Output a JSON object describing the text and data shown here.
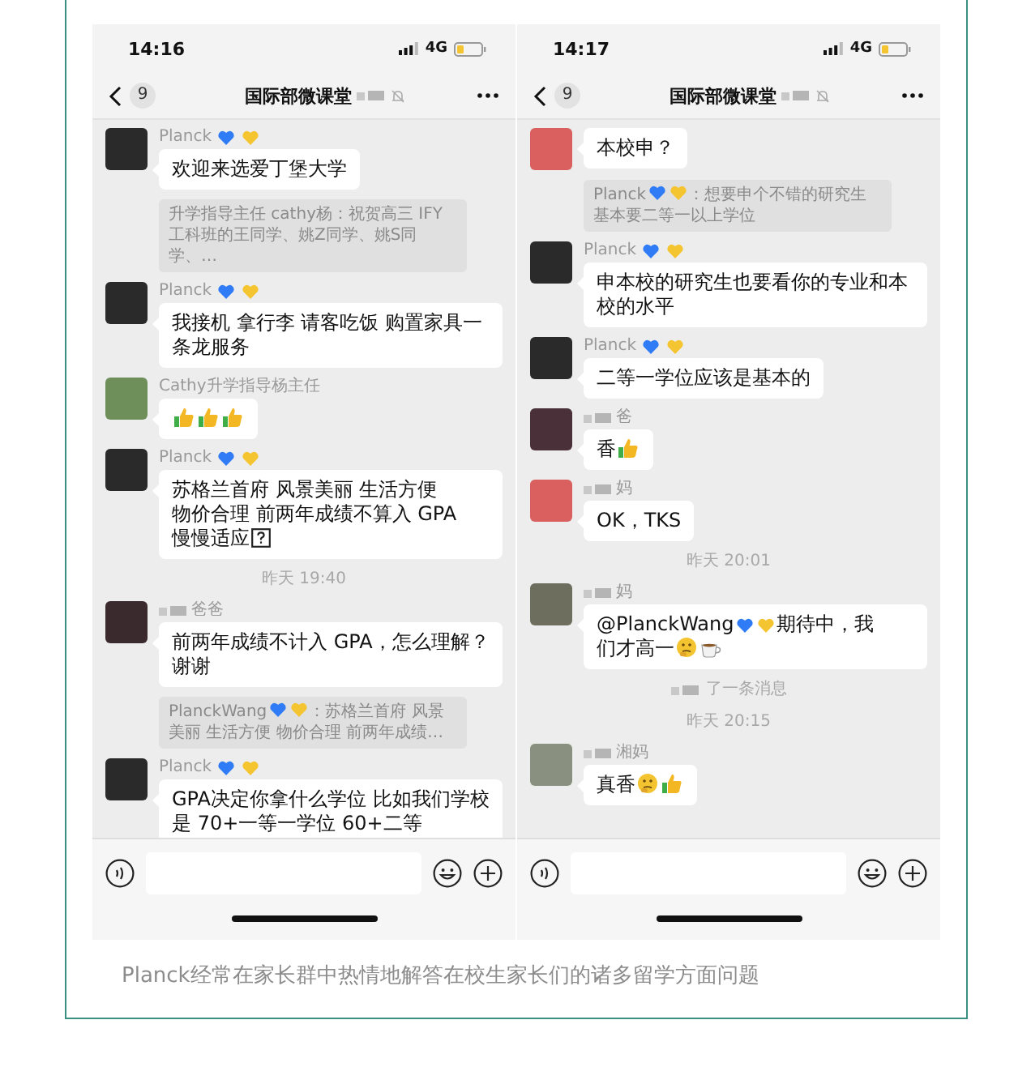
{
  "phones": [
    {
      "status": {
        "time": "14:16",
        "network": "4G"
      },
      "nav": {
        "badge": "9",
        "title": "国际部微课堂",
        "redacted": true,
        "muted": true
      },
      "messages": [
        {
          "kind": "message",
          "sender": {
            "name": "Planck",
            "badges": [
              {
                "kind": "heart",
                "color": "#2f7cf6"
              },
              {
                "kind": "heart",
                "color": "#f5c431"
              }
            ]
          },
          "avatar": {
            "color": "#2a2a2a"
          },
          "parts": [
            {
              "kind": "text",
              "text": "欢迎来选爱丁堡大学"
            }
          ]
        },
        {
          "kind": "quote",
          "parts": [
            {
              "kind": "text",
              "text": "升学指导主任 cathy杨：祝贺高三 IFY 工科班的王同学、姚Z同学、姚S同学、…"
            }
          ]
        },
        {
          "kind": "message",
          "sender": {
            "name": "Planck",
            "badges": [
              {
                "kind": "heart",
                "color": "#2f7cf6"
              },
              {
                "kind": "heart",
                "color": "#f5c431"
              }
            ]
          },
          "avatar": {
            "color": "#2a2a2a"
          },
          "parts": [
            {
              "kind": "text",
              "text": "我接机 拿行李 请客吃饭 购置家具一条龙服务"
            }
          ]
        },
        {
          "kind": "message",
          "sender": {
            "name": "Cathy升学指导杨主任"
          },
          "avatar": {
            "color": "#6f8f5a"
          },
          "parts": [
            {
              "kind": "thumb"
            },
            {
              "kind": "thumb"
            },
            {
              "kind": "thumb"
            }
          ]
        },
        {
          "kind": "message",
          "sender": {
            "name": "Planck",
            "badges": [
              {
                "kind": "heart",
                "color": "#2f7cf6"
              },
              {
                "kind": "heart",
                "color": "#f5c431"
              }
            ]
          },
          "avatar": {
            "color": "#2a2a2a"
          },
          "parts": [
            {
              "kind": "text",
              "text": "苏格兰首府 风景美丽 生活方便"
            },
            {
              "kind": "text",
              "text": "物价合理 前两年成绩不算入 GPA"
            },
            {
              "kind": "text",
              "text": "慢慢适应"
            },
            {
              "kind": "unknown"
            }
          ]
        },
        {
          "kind": "time",
          "text": "昨天 19:40"
        },
        {
          "kind": "message",
          "sender": {
            "name": "爸爸",
            "redacted": true
          },
          "avatar": {
            "color": "#3a2a2e"
          },
          "parts": [
            {
              "kind": "text",
              "text": "前两年成绩不计入 GPA，怎么理解？谢谢"
            }
          ]
        },
        {
          "kind": "quote",
          "parts": [
            {
              "kind": "text",
              "text": "PlanckWang"
            },
            {
              "kind": "heart",
              "color": "#2f7cf6"
            },
            {
              "kind": "heart",
              "color": "#f5c431"
            },
            {
              "kind": "text",
              "text": "：苏格兰首府 风景"
            },
            {
              "kind": "text",
              "text": "美丽 生活方便 物价合理 前两年成绩…"
            }
          ]
        },
        {
          "kind": "message",
          "sender": {
            "name": "Planck",
            "badges": [
              {
                "kind": "heart",
                "color": "#2f7cf6"
              },
              {
                "kind": "heart",
                "color": "#f5c431"
              }
            ]
          },
          "avatar": {
            "color": "#2a2a2a"
          },
          "parts": [
            {
              "kind": "text",
              "text": "GPA决定你拿什么学位 比如我们学校是 70+一等一学位 60+二等"
            }
          ]
        }
      ]
    },
    {
      "status": {
        "time": "14:17",
        "network": "4G"
      },
      "nav": {
        "badge": "9",
        "title": "国际部微课堂",
        "redacted": true,
        "muted": true
      },
      "messages": [
        {
          "kind": "message",
          "avatar": {
            "color": "#d9605e"
          },
          "parts": [
            {
              "kind": "text",
              "text": "本校申？"
            }
          ]
        },
        {
          "kind": "quote",
          "parts": [
            {
              "kind": "text",
              "text": "Planck"
            },
            {
              "kind": "heart",
              "color": "#2f7cf6"
            },
            {
              "kind": "heart",
              "color": "#f5c431"
            },
            {
              "kind": "text",
              "text": "：想要申个不错的研究生"
            },
            {
              "kind": "text",
              "text": "基本要二等一以上学位"
            }
          ]
        },
        {
          "kind": "message",
          "sender": {
            "name": "Planck",
            "badges": [
              {
                "kind": "heart",
                "color": "#2f7cf6"
              },
              {
                "kind": "heart",
                "color": "#f5c431"
              }
            ]
          },
          "avatar": {
            "color": "#2a2a2a"
          },
          "parts": [
            {
              "kind": "text",
              "text": "申本校的研究生也要看你的专业和本校的水平"
            }
          ]
        },
        {
          "kind": "message",
          "sender": {
            "name": "Planck",
            "badges": [
              {
                "kind": "heart",
                "color": "#2f7cf6"
              },
              {
                "kind": "heart",
                "color": "#f5c431"
              }
            ]
          },
          "avatar": {
            "color": "#2a2a2a"
          },
          "parts": [
            {
              "kind": "text",
              "text": "二等一学位应该是基本的"
            }
          ]
        },
        {
          "kind": "message",
          "sender": {
            "name": "爸",
            "redacted": true
          },
          "avatar": {
            "color": "#4a3038"
          },
          "parts": [
            {
              "kind": "text",
              "text": "香"
            },
            {
              "kind": "thumb"
            }
          ]
        },
        {
          "kind": "message",
          "sender": {
            "name": "妈",
            "redacted": true
          },
          "avatar": {
            "color": "#d9605e"
          },
          "parts": [
            {
              "kind": "text",
              "text": "OK，TKS"
            }
          ]
        },
        {
          "kind": "time",
          "text": "昨天 20:01"
        },
        {
          "kind": "message",
          "sender": {
            "name": "妈",
            "redacted": true
          },
          "avatar": {
            "color": "#6e6e5e"
          },
          "parts": [
            {
              "kind": "text",
              "text": "@PlanckWang"
            },
            {
              "kind": "heart",
              "color": "#2f7cf6"
            },
            {
              "kind": "heart",
              "color": "#f5c431"
            },
            {
              "kind": "text",
              "text": "期待中，我"
            },
            {
              "kind": "text",
              "text": "们才高一"
            },
            {
              "kind": "think"
            },
            {
              "kind": "coffee"
            }
          ]
        },
        {
          "kind": "notice",
          "redacted": true,
          "text": "了一条消息"
        },
        {
          "kind": "time",
          "text": "昨天 20:15"
        },
        {
          "kind": "message",
          "sender": {
            "name": "湘妈",
            "redacted": true
          },
          "avatar": {
            "color": "#8a9080"
          },
          "parts": [
            {
              "kind": "text",
              "text": "真香"
            },
            {
              "kind": "think"
            },
            {
              "kind": "thumb"
            }
          ]
        }
      ]
    }
  ],
  "caption": "Planck经常在家长群中热情地解答在校生家长们的诸多留学方面问题"
}
